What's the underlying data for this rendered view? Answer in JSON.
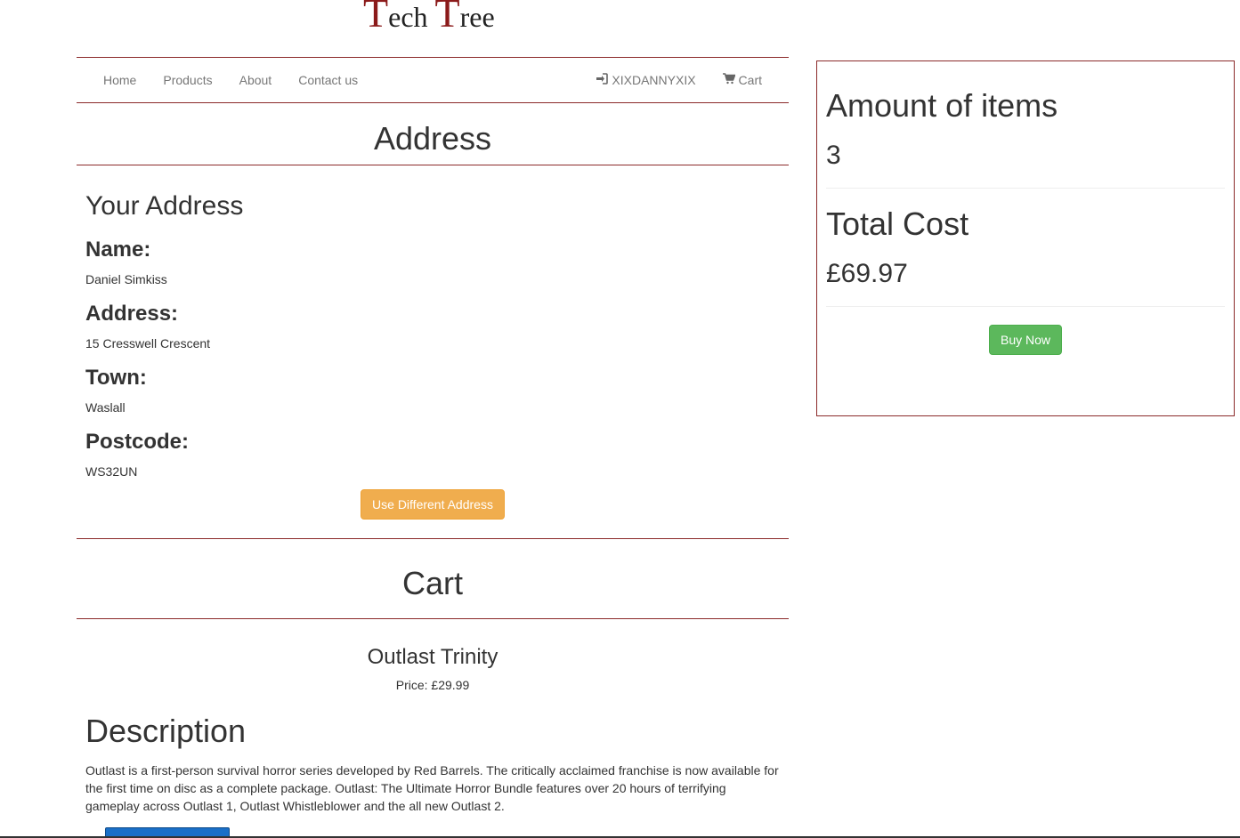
{
  "logo": {
    "cap1": "T",
    "rest1": "ech ",
    "cap2": "T",
    "rest2": "ree"
  },
  "nav": {
    "left": [
      "Home",
      "Products",
      "About",
      "Contact us"
    ],
    "user": "XIXDANNYXIX",
    "cart": "Cart"
  },
  "address_section": {
    "title": "Address",
    "subtitle": "Your Address",
    "name_label": "Name:",
    "name_value": "Daniel Simkiss",
    "address_label": "Address:",
    "address_value": "15 Cresswell Crescent",
    "town_label": "Town:",
    "town_value": "Waslall",
    "postcode_label": "Postcode:",
    "postcode_value": "WS32UN",
    "change_button": "Use Different Address"
  },
  "cart_section": {
    "title": "Cart",
    "product_name": "Outlast Trinity",
    "product_price": "Price: £29.99",
    "description_title": "Description",
    "description_text": "Outlast is a first-person survival horror series developed by Red Barrels. The critically acclaimed franchise is now available for the first time on disc as a complete package. Outlast: The Ultimate Horror Bundle features over 20 hours of terrifying gameplay across Outlast 1, Outlast Whistleblower and the all new Outlast 2."
  },
  "summary": {
    "items_label": "Amount of items",
    "items_value": "3",
    "total_label": "Total Cost",
    "total_value": "£69.97",
    "buy_button": "Buy Now"
  },
  "colors": {
    "accent_border": "#8b2a2a",
    "warning": "#f0ad4e",
    "success": "#5cb85c"
  },
  "icons": {
    "login": "sign-in-icon",
    "cart": "shopping-cart-icon"
  }
}
